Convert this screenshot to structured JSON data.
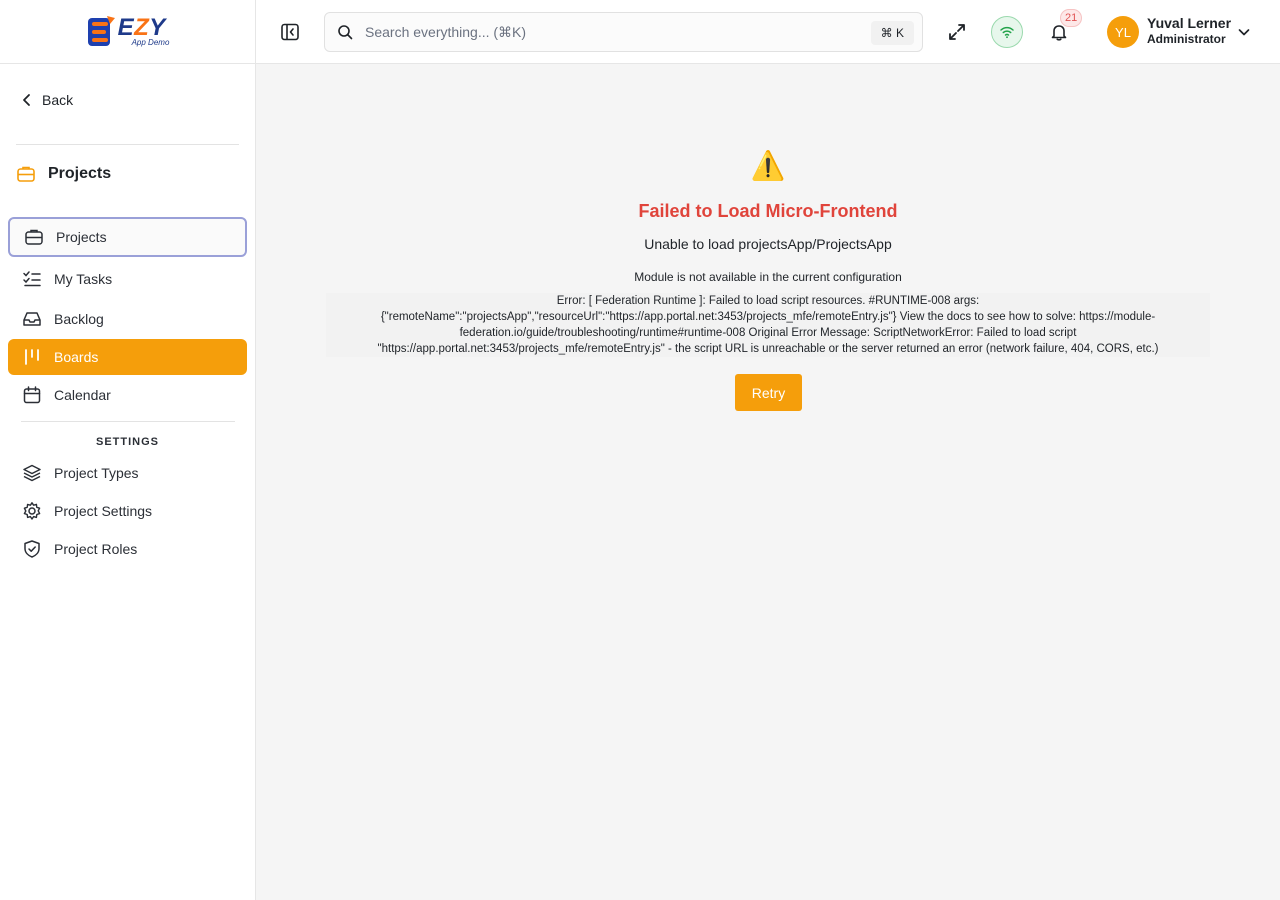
{
  "brand": {
    "name": "EZY",
    "subtitle": "App Demo"
  },
  "sidebar": {
    "back_label": "Back",
    "section_title": "Projects",
    "items": [
      {
        "label": "Projects",
        "icon": "briefcase-icon"
      },
      {
        "label": "My Tasks",
        "icon": "checklist-icon"
      },
      {
        "label": "Backlog",
        "icon": "inbox-icon"
      },
      {
        "label": "Boards",
        "icon": "board-columns-icon"
      },
      {
        "label": "Calendar",
        "icon": "calendar-icon"
      }
    ],
    "settings_label": "SETTINGS",
    "settings_items": [
      {
        "label": "Project Types",
        "icon": "layers-icon"
      },
      {
        "label": "Project Settings",
        "icon": "gear-icon"
      },
      {
        "label": "Project Roles",
        "icon": "shield-check-icon"
      }
    ]
  },
  "header": {
    "search_placeholder": "Search everything... (⌘K)",
    "search_shortcut": "⌘ K",
    "notification_count": "21",
    "user": {
      "initials": "YL",
      "name": "Yuval Lerner",
      "role": "Administrator"
    }
  },
  "error": {
    "icon": "⚠️",
    "title": "Failed to Load Micro-Frontend",
    "subtitle": "Unable to load projectsApp/ProjectsApp",
    "message": "Module is not available in the current configuration",
    "detail": "Error: [ Federation Runtime ]: Failed to load script resources. #RUNTIME-008 args: {\"remoteName\":\"projectsApp\",\"resourceUrl\":\"https://app.portal.net:3453/projects_mfe/remoteEntry.js\"} View the docs to see how to solve: https://module-federation.io/guide/troubleshooting/runtime#runtime-008 Original Error Message: ScriptNetworkError: Failed to load script \"https://app.portal.net:3453/projects_mfe/remoteEntry.js\" - the script URL is unreachable or the server returned an error (network failure, 404, CORS, etc.)",
    "retry_label": "Retry"
  },
  "colors": {
    "accent": "#f59e0b",
    "error": "#e0443b",
    "selected_border": "#9aa0d8"
  }
}
